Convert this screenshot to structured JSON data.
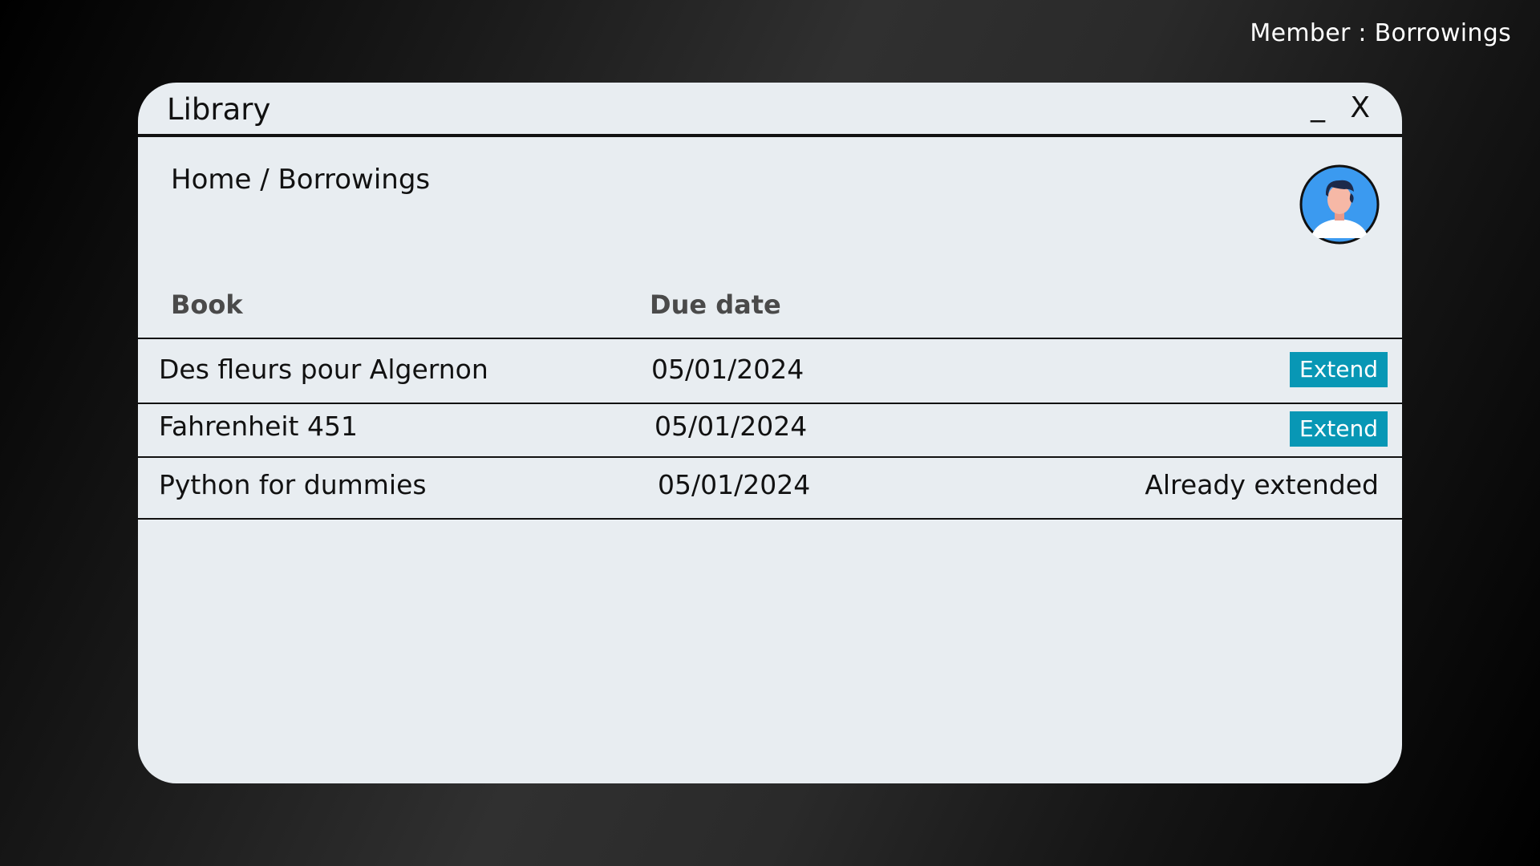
{
  "page_caption": "Member : Borrowings",
  "window": {
    "title": "Library",
    "minimize_label": "_",
    "close_label": "X"
  },
  "breadcrumb": "Home / Borrowings",
  "avatar": {
    "icon": "user-avatar-icon"
  },
  "table": {
    "headers": {
      "book": "Book",
      "due_date": "Due date"
    },
    "rows": [
      {
        "book": "Des fleurs pour Algernon",
        "due_date": "05/01/2024",
        "action": "Extend"
      },
      {
        "book": "Fahrenheit 451",
        "due_date": "05/01/2024",
        "action": "Extend"
      },
      {
        "book": "Python for dummies",
        "due_date": "05/01/2024",
        "status": "Already extended"
      }
    ]
  },
  "colors": {
    "window_bg": "#e8edf1",
    "extend_button": "#0897b5",
    "avatar_bg": "#3b9af0"
  }
}
